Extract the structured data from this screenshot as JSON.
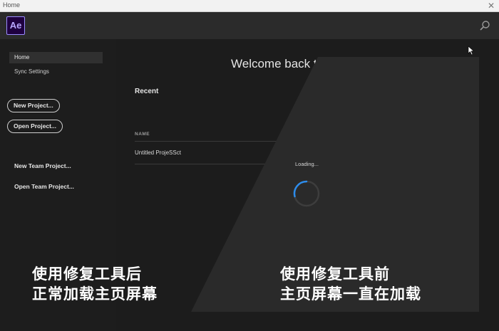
{
  "window": {
    "title": "Home",
    "close_glyph": "✕"
  },
  "header": {
    "app_logo": "Ae",
    "search_icon": "search-icon"
  },
  "sidebar": {
    "items": [
      {
        "label": "Home",
        "active": true
      },
      {
        "label": "Sync Settings",
        "active": false
      }
    ],
    "buttons": {
      "new_project": "New Project...",
      "open_project": "Open Project..."
    },
    "links": {
      "new_team_project": "New Team Project...",
      "open_team_project": "Open Team Project..."
    }
  },
  "main": {
    "welcome": "Welcome back to",
    "recent_title": "Recent",
    "column_name": "NAME",
    "projects": [
      {
        "name": "Untitled ProjeSSct"
      }
    ]
  },
  "loading_panel": {
    "label": "Loading..."
  },
  "captions": {
    "left_line1": "使用修复工具后",
    "left_line2": "正常加载主页屏幕",
    "right_line1": "使用修复工具前",
    "right_line2": "主页屏幕一直在加载"
  },
  "colors": {
    "accent": "#9a8cff",
    "logo_bg": "#1f0040",
    "overlay": "#2a2a2a"
  }
}
